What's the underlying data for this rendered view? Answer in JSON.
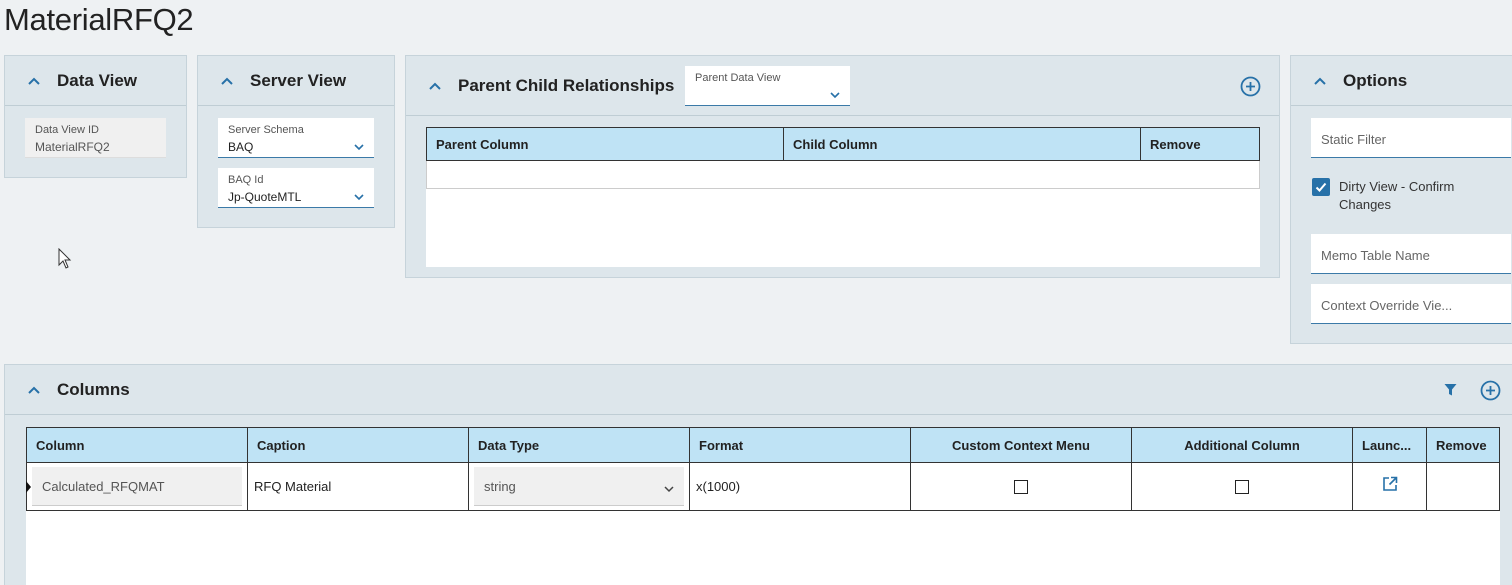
{
  "page": {
    "title": "MaterialRFQ2"
  },
  "data_view": {
    "title": "Data View",
    "id_label": "Data View ID",
    "id_value": "MaterialRFQ2"
  },
  "server_view": {
    "title": "Server View",
    "schema_label": "Server Schema",
    "schema_value": "BAQ",
    "baq_label": "BAQ Id",
    "baq_value": "Jp-QuoteMTL"
  },
  "parent_child": {
    "title": "Parent Child Relationships",
    "parent_data_view_label": "Parent Data View",
    "columns": [
      "Parent Column",
      "Child Column",
      "Remove"
    ]
  },
  "options": {
    "title": "Options",
    "static_filter_placeholder": "Static Filter",
    "dirty_view_label": "Dirty View - Confirm Changes",
    "dirty_view_checked": true,
    "memo_table_placeholder": "Memo Table Name",
    "context_override_placeholder": "Context Override Vie..."
  },
  "columns_panel": {
    "title": "Columns",
    "headers": [
      "Column",
      "Caption",
      "Data Type",
      "Format",
      "Custom Context Menu",
      "Additional Column",
      "Launc...",
      "Remove"
    ],
    "rows": [
      {
        "column": "Calculated_RFQMAT",
        "caption": "RFQ Material",
        "data_type": "string",
        "format": "x(1000)",
        "custom_context_menu": false,
        "additional_column": false
      }
    ]
  },
  "colors": {
    "accent": "#2771a8",
    "header_bg": "#bfe3f5",
    "card_bg": "#dde6eb"
  }
}
